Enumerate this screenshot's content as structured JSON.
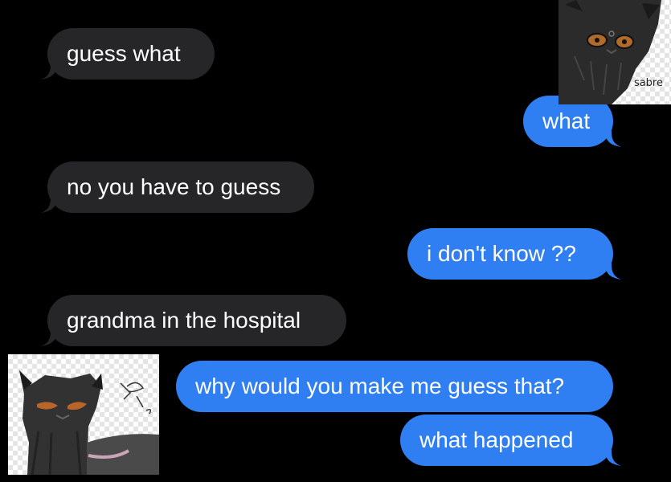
{
  "messages": [
    {
      "text": "guess what",
      "direction": "received"
    },
    {
      "text": "what",
      "direction": "sent"
    },
    {
      "text": "no you have to guess",
      "direction": "received"
    },
    {
      "text": "i don't know ??",
      "direction": "sent"
    },
    {
      "text": "grandma in the hospital",
      "direction": "received"
    },
    {
      "text": "why would you make me guess that?",
      "direction": "sent"
    },
    {
      "text": "what happened",
      "direction": "sent"
    }
  ],
  "stickers": {
    "top_caption": "sabre"
  },
  "colors": {
    "background": "#000000",
    "received_bubble": "#262628",
    "sent_bubble": "#2f7ff2",
    "text": "#ffffff"
  }
}
